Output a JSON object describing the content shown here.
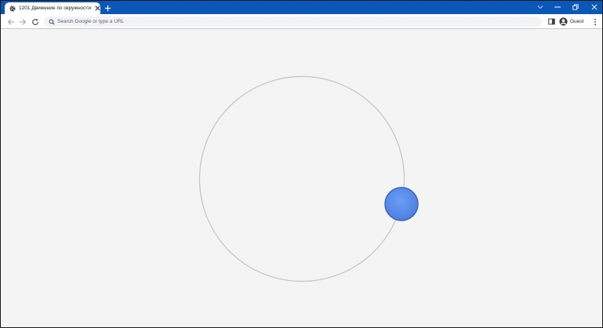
{
  "tab": {
    "title": "1201 Движение по окружности",
    "favicon": "globe-icon"
  },
  "toolbar": {
    "omnibox_placeholder": "Search Google or type a URL",
    "profile_label": "Guest"
  },
  "icons": {
    "back": "back-arrow-icon",
    "forward": "forward-arrow-icon",
    "reload": "reload-icon",
    "search": "search-icon",
    "side_panel": "side-panel-icon",
    "profile": "profile-avatar-icon",
    "menu": "kebab-menu-icon",
    "new_tab": "plus-icon",
    "close": "close-icon",
    "tab_search": "chevron-down-icon",
    "minimize": "minimize-icon",
    "restore": "restore-icon",
    "window_close": "window-close-icon"
  },
  "colors": {
    "tabstrip": "#0b57b8",
    "orbit_stroke": "#c4c4c4",
    "ball_fill": "#5b8ff0",
    "ball_stroke": "#3a63b5",
    "page_background": "#f4f4f4"
  }
}
